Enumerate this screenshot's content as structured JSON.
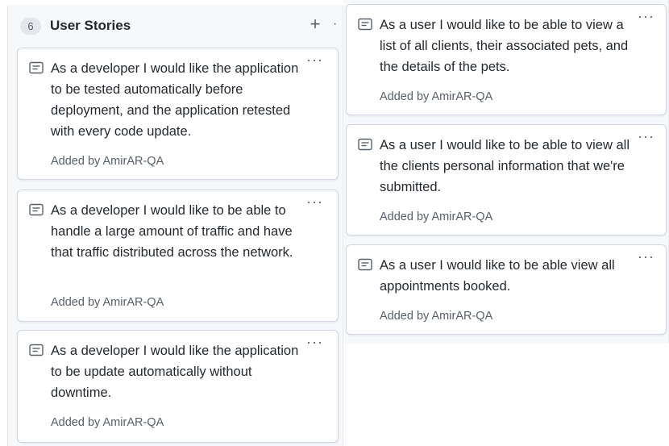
{
  "column_left": {
    "count": "6",
    "title": "User Stories",
    "add_label": "+",
    "more_label": "·"
  },
  "cards_left": [
    {
      "title": "As a developer I would like the application to be tested automatically before deployment, and the application retested with every code update.",
      "added_by_prefix": "Added by",
      "added_by_user": "AmirAR-QA",
      "more": "···"
    },
    {
      "title": "As a developer I would like to be able to handle a large amount of traffic and have that traffic distributed across the network.",
      "added_by_prefix": "Added by",
      "added_by_user": "AmirAR-QA",
      "more": "···"
    },
    {
      "title": "As a developer I would like the application to be update automatically without downtime.",
      "added_by_prefix": "Added by",
      "added_by_user": "AmirAR-QA",
      "more": "···"
    }
  ],
  "cards_right": [
    {
      "title": "As a user I would like to be able to view a list of all clients, their associated pets, and the details of the pets.",
      "added_by_prefix": "Added by",
      "added_by_user": "AmirAR-QA",
      "more": "···"
    },
    {
      "title": "As a user I would like to be able to view all the clients personal information that we're submitted.",
      "added_by_prefix": "Added by",
      "added_by_user": "AmirAR-QA",
      "more": "···"
    },
    {
      "title": "As a user I would like to be able view all appointments booked.",
      "added_by_prefix": "Added by",
      "added_by_user": "AmirAR-QA",
      "more": "···"
    }
  ],
  "colors": {
    "text": "#24292f",
    "muted": "#57606a",
    "border": "#d0d7de",
    "column_bg": "#f6f8fa"
  },
  "icons": {
    "card_icon": "note-icon",
    "add_icon": "plus-icon",
    "more_icon": "kebab-horizontal-icon"
  }
}
